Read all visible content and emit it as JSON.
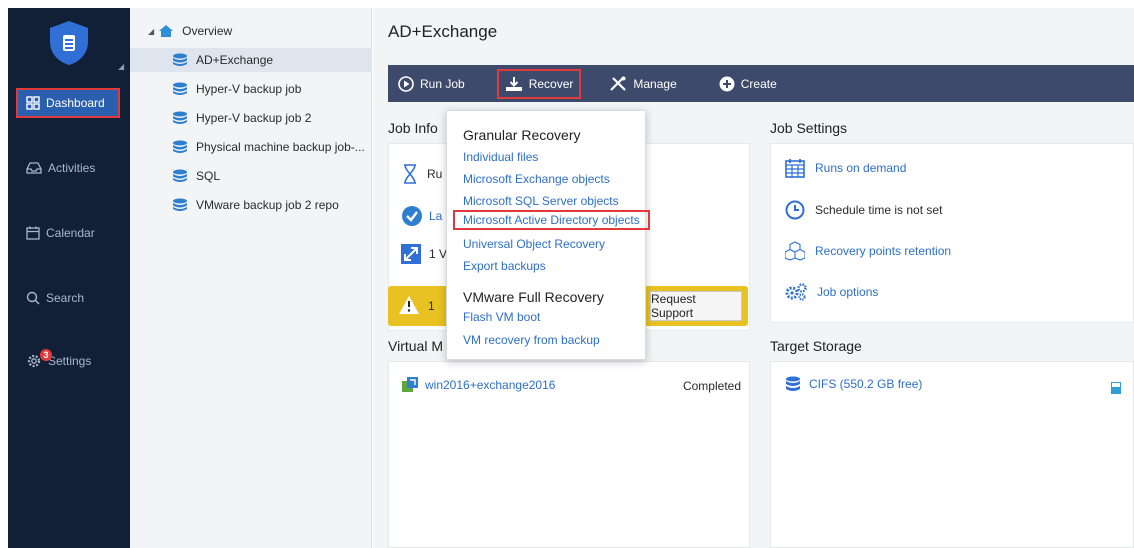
{
  "nav": {
    "dashboard": "Dashboard",
    "activities": "Activities",
    "calendar": "Calendar",
    "search": "Search",
    "settings": "Settings",
    "settings_badge": "3"
  },
  "tree": {
    "root": "Overview",
    "items": [
      "AD+Exchange",
      "Hyper-V backup job",
      "Hyper-V backup job 2",
      "Physical machine backup job-...",
      "SQL",
      "VMware backup job 2 repo"
    ]
  },
  "header": {
    "title": "AD+Exchange"
  },
  "toolbar": {
    "run_job": "Run Job",
    "recover": "Recover",
    "manage": "Manage",
    "create": "Create"
  },
  "job_info": {
    "title": "Job Info",
    "rows": [
      "Ru",
      "La",
      "1 V"
    ],
    "warning_text": "1",
    "request_support": "Request Support"
  },
  "job_settings": {
    "title": "Job Settings",
    "runs_on_demand": "Runs on demand",
    "schedule": "Schedule time is not set",
    "retention": "Recovery points retention",
    "options": "Job options"
  },
  "virtual_machines": {
    "title": "Virtual M",
    "vm_name": "win2016+exchange2016",
    "status": "Completed"
  },
  "target_storage": {
    "title": "Target Storage",
    "name": "CIFS (550.2 GB free)"
  },
  "dropdown": {
    "granular_header": "Granular Recovery",
    "granular_items": [
      "Individual files",
      "Microsoft Exchange objects",
      "Microsoft SQL Server objects",
      "Microsoft Active Directory objects",
      "Universal Object Recovery",
      "Export backups"
    ],
    "vmware_header": "VMware Full Recovery",
    "vmware_items": [
      "Flash VM boot",
      "VM recovery from backup"
    ]
  },
  "colors": {
    "nav_bg": "#112036",
    "toolbar_bg": "#3d4a6b",
    "accent_blue": "#2d6fc9",
    "highlight_red": "#e03a3a",
    "warning_yellow": "#e7c222"
  }
}
